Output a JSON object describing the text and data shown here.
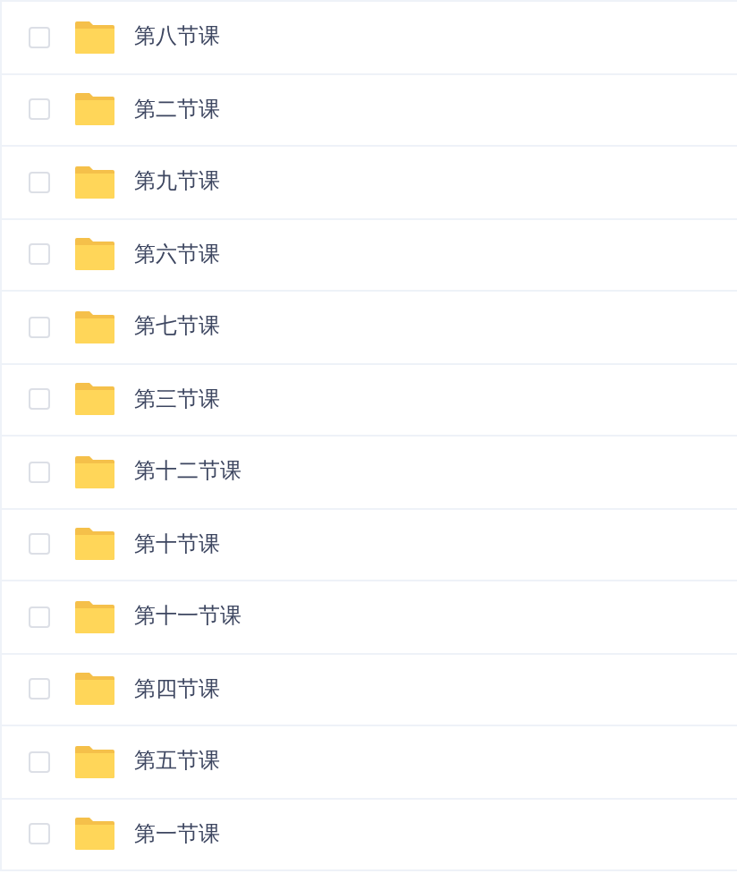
{
  "files": [
    {
      "name": "第八节课",
      "checked": false
    },
    {
      "name": "第二节课",
      "checked": false
    },
    {
      "name": "第九节课",
      "checked": false
    },
    {
      "name": "第六节课",
      "checked": false
    },
    {
      "name": "第七节课",
      "checked": false
    },
    {
      "name": "第三节课",
      "checked": false
    },
    {
      "name": "第十二节课",
      "checked": false
    },
    {
      "name": "第十节课",
      "checked": false
    },
    {
      "name": "第十一节课",
      "checked": false
    },
    {
      "name": "第四节课",
      "checked": false
    },
    {
      "name": "第五节课",
      "checked": false
    },
    {
      "name": "第一节课",
      "checked": false
    }
  ]
}
